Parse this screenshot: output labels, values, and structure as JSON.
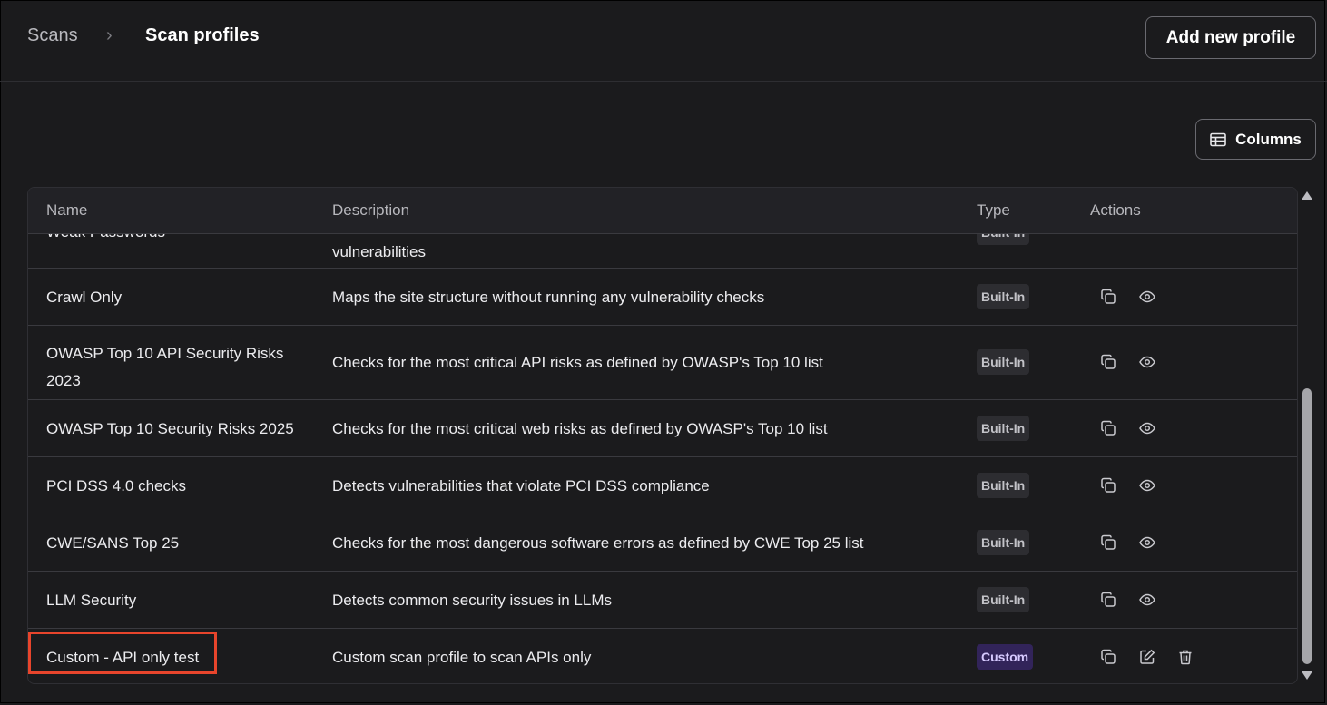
{
  "breadcrumb": {
    "root": "Scans",
    "separator": "›",
    "current": "Scan profiles"
  },
  "toolbar": {
    "add_label": "Add new profile",
    "columns_label": "Columns"
  },
  "table": {
    "headers": {
      "name": "Name",
      "description": "Description",
      "type": "Type",
      "actions": "Actions"
    },
    "partial_row": {
      "name": "Weak Passwords",
      "description": "vulnerabilities",
      "type": "Built-In"
    },
    "rows": [
      {
        "name": "Crawl Only",
        "description": "Maps the site structure without running any vulnerability checks",
        "type": "Built-In"
      },
      {
        "name": "OWASP Top 10 API Security Risks 2023",
        "description": "Checks for the most critical API risks as defined by OWASP's Top 10 list",
        "type": "Built-In"
      },
      {
        "name": "OWASP Top 10 Security Risks 2025",
        "description": "Checks for the most critical web risks as defined by OWASP's Top 10 list",
        "type": "Built-In"
      },
      {
        "name": "PCI DSS 4.0 checks",
        "description": "Detects vulnerabilities that violate PCI DSS compliance",
        "type": "Built-In"
      },
      {
        "name": "CWE/SANS Top 25",
        "description": "Checks for the most dangerous software errors as defined by CWE Top 25 list",
        "type": "Built-In"
      },
      {
        "name": "LLM Security",
        "description": "Detects common security issues in LLMs",
        "type": "Built-In"
      },
      {
        "name": "Custom - API only test",
        "description": "Custom scan profile to scan APIs only",
        "type": "Custom"
      }
    ]
  },
  "icons": {
    "copy": "copy-icon",
    "view": "eye-icon",
    "edit": "edit-icon",
    "delete": "trash-icon",
    "columns": "table-columns-icon"
  },
  "colors": {
    "highlight": "#e8452c",
    "custom_badge": "#32245a",
    "builtin_badge": "#2d2d31"
  }
}
